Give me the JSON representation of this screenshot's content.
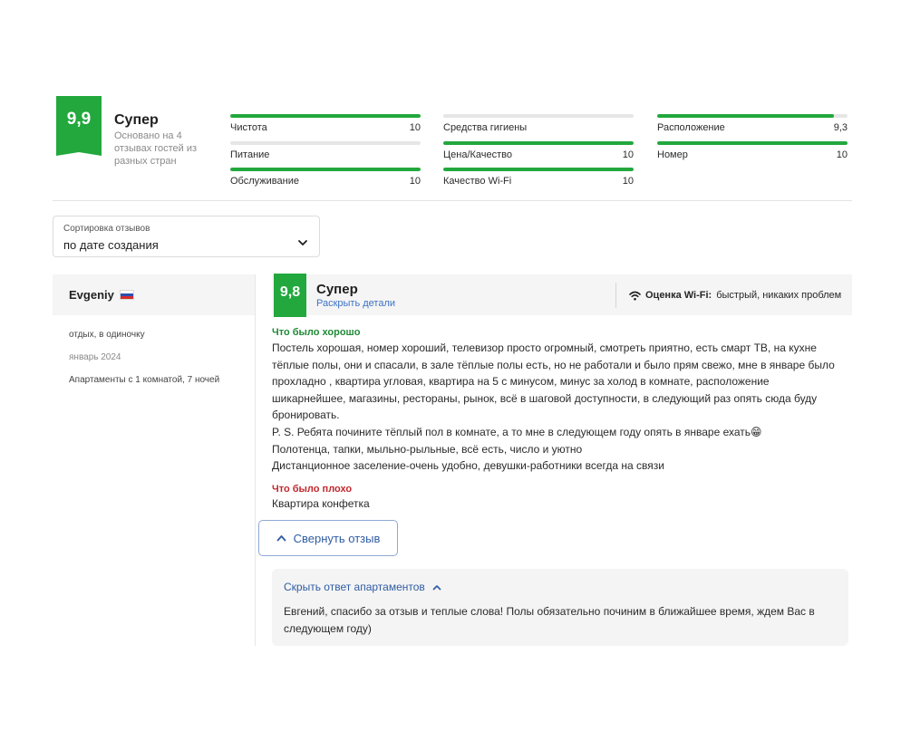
{
  "summary": {
    "score": "9,9",
    "word": "Супер",
    "subtitle": "Основано на 4 отзывах гостей из разных стран"
  },
  "categories": [
    {
      "name": "Чистота",
      "value": "10",
      "fraction": 1.0
    },
    {
      "name": "Питание",
      "value": "",
      "fraction": 0.0
    },
    {
      "name": "Обслуживание",
      "value": "10",
      "fraction": 1.0
    },
    {
      "name": "Средства гигиены",
      "value": "",
      "fraction": 0.0
    },
    {
      "name": "Цена/Качество",
      "value": "10",
      "fraction": 1.0
    },
    {
      "name": "Качество Wi-Fi",
      "value": "10",
      "fraction": 1.0
    },
    {
      "name": "Расположение",
      "value": "9,3",
      "fraction": 0.93
    },
    {
      "name": "Номер",
      "value": "10",
      "fraction": 1.0
    }
  ],
  "sort": {
    "label": "Сортировка отзывов",
    "value": "по дате создания"
  },
  "review": {
    "author": "Evgeniy",
    "trip_type": "отдых, в одиночку",
    "date": "январь 2024",
    "room": "Апартаменты с 1 комнатой, 7 ночей",
    "score": "9,8",
    "word": "Супер",
    "details_link": "Раскрыть детали",
    "wifi_label": "Оценка Wi-Fi:",
    "wifi_value": "быстрый, никаких проблем",
    "good_heading": "Что было хорошо",
    "good_lines": [
      "Постель хорошая, номер хороший, телевизор просто огромный, смотреть приятно, есть смарт ТВ, на кухне",
      "тёплые полы, они и спасали, в зале тёплые полы есть, но не работали и было прям свежо, мне в январе было",
      "прохладно , квартира угловая, квартира на 5 с минусом, минус за холод в комнате, расположение",
      "шикарнейшее, магазины, рестораны, рынок, всё в шаговой доступности, в следующий раз опять сюда буду",
      "бронировать.",
      "P. S. Ребята почините тёплый пол в комнате, а то мне в следующем году опять в январе ехать😁",
      "Полотенца, тапки, мыльно-рыльные, всё есть, число и уютно",
      "Дистанционное заселение-очень удобно, девушки-работники всегда на связи"
    ],
    "bad_heading": "Что было плохо",
    "bad_text": "Квартира конфетка",
    "collapse_label": "Свернуть отзыв",
    "reply_toggle": "Скрыть ответ апартаментов",
    "reply_text": "Евгений, спасибо за отзыв и теплые слова! Полы обязательно починим в ближайшее время, ждем Вас в следующем году)"
  },
  "colors": {
    "score_green": "#22a83d",
    "link_blue": "#2f5ca3",
    "good_green": "#1f8a35",
    "bad_red": "#c0282d"
  }
}
